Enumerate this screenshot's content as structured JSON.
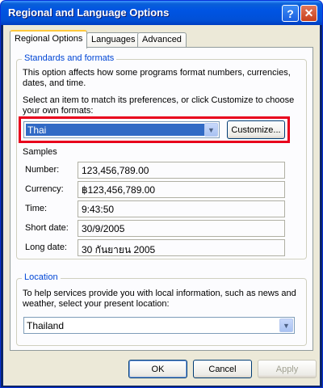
{
  "window": {
    "title": "Regional and Language Options",
    "help_glyph": "?",
    "close_glyph": "✕"
  },
  "tabs": [
    {
      "label": "Regional Options",
      "active": true
    },
    {
      "label": "Languages",
      "active": false
    },
    {
      "label": "Advanced",
      "active": false
    }
  ],
  "standards": {
    "title": "Standards and formats",
    "description": "This option affects how some programs format numbers, currencies, dates, and time.",
    "instruction": "Select an item to match its preferences, or click Customize to choose your own formats:",
    "selected_format": "Thai",
    "customize_label": "Customize...",
    "samples_title": "Samples",
    "samples": [
      {
        "label": "Number:",
        "value": "123,456,789.00"
      },
      {
        "label": "Currency:",
        "value": "฿123,456,789.00"
      },
      {
        "label": "Time:",
        "value": "9:43:50"
      },
      {
        "label": "Short date:",
        "value": "30/9/2005"
      },
      {
        "label": "Long date:",
        "value": "30 กันยายน 2005"
      }
    ]
  },
  "location": {
    "title": "Location",
    "description": "To help services provide you with local information, such as news and weather, select your present location:",
    "selected": "Thailand"
  },
  "buttons": {
    "ok": "OK",
    "cancel": "Cancel",
    "apply": "Apply"
  },
  "colors": {
    "highlight": "#e8001c",
    "title_bar": "#0054e3",
    "group_title": "#0046d5",
    "selection": "#316ac5"
  }
}
